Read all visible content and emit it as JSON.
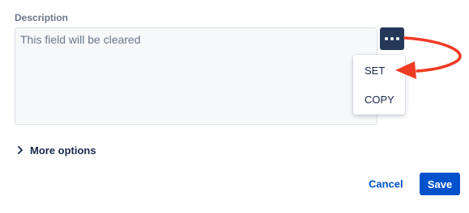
{
  "field": {
    "label": "Description",
    "placeholder": "This field will be cleared"
  },
  "actions_menu": {
    "icon": "more-horizontal-icon",
    "items": [
      {
        "label": "SET"
      },
      {
        "label": "COPY"
      }
    ]
  },
  "more_options": {
    "icon": "chevron-right-icon",
    "label": "More options"
  },
  "footer": {
    "cancel_label": "Cancel",
    "save_label": "Save"
  },
  "colors": {
    "accent": "#0052cc",
    "button_dark": "#253858",
    "annotation_arrow": "#ef3b24"
  }
}
